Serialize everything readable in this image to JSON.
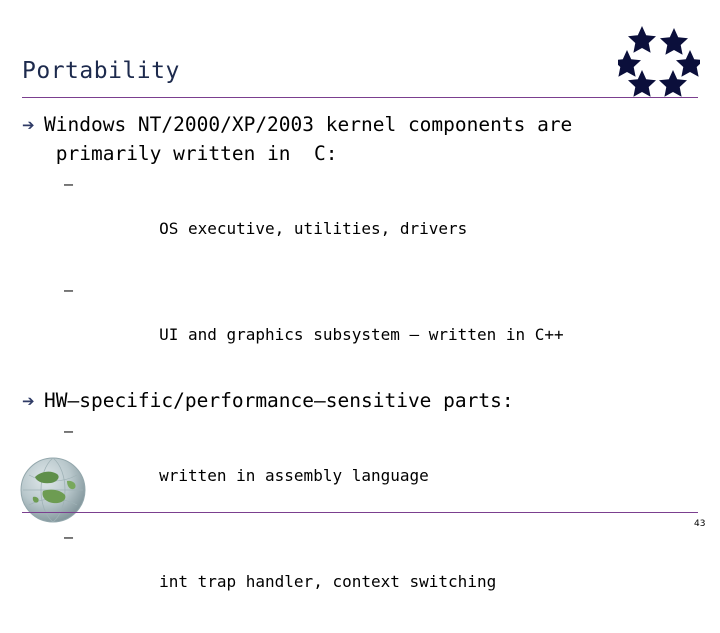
{
  "slide": {
    "title": "Portability",
    "page_number": "43",
    "accent_color": "#7b3f8f",
    "title_color": "#1d2a4d",
    "bullets": [
      {
        "marker": "➔",
        "text": "Windows NT/2000/XP/2003 kernel components are\n primarily written in  C:",
        "sub": [
          {
            "marker": "–",
            "text": "OS executive, utilities, drivers"
          },
          {
            "marker": "–",
            "text": "UI and graphics subsystem – written in C++"
          }
        ]
      },
      {
        "marker": "➔",
        "text": "HW–specific/performance–sensitive parts:",
        "sub": [
          {
            "marker": "–",
            "text": "written in assembly language"
          },
          {
            "marker": "–",
            "text": "int trap handler, context switching"
          }
        ]
      }
    ],
    "decorations": {
      "stars_emblem": "seven-stars-icon",
      "globe_emblem": "globe-icon"
    }
  }
}
